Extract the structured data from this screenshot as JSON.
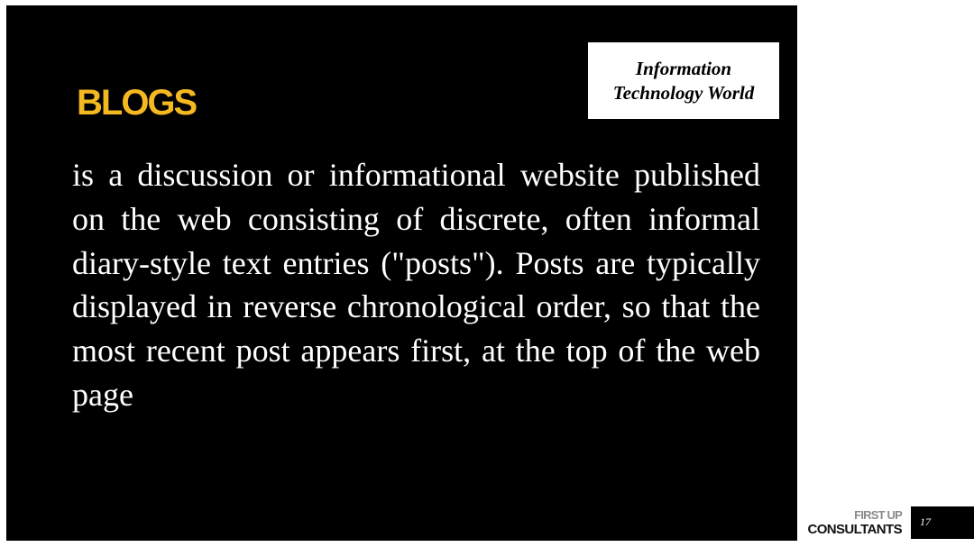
{
  "slide": {
    "title": "BLOGS",
    "brand_line_1": "Information",
    "brand_line_2": "Technology World",
    "body": "is a discussion or informational website published on the web consisting of discrete, often informal diary-style text entries (\"posts\"). Posts are typically displayed in reverse chronological order, so that the most recent post appears first, at the top of the web page"
  },
  "footer": {
    "logo_top": "FIRST UP",
    "logo_bottom": "CONSULTANTS",
    "page_number": "17"
  },
  "colors": {
    "title_accent": "#f4b821",
    "panel_background": "#000000",
    "body_text": "#ffffff"
  }
}
